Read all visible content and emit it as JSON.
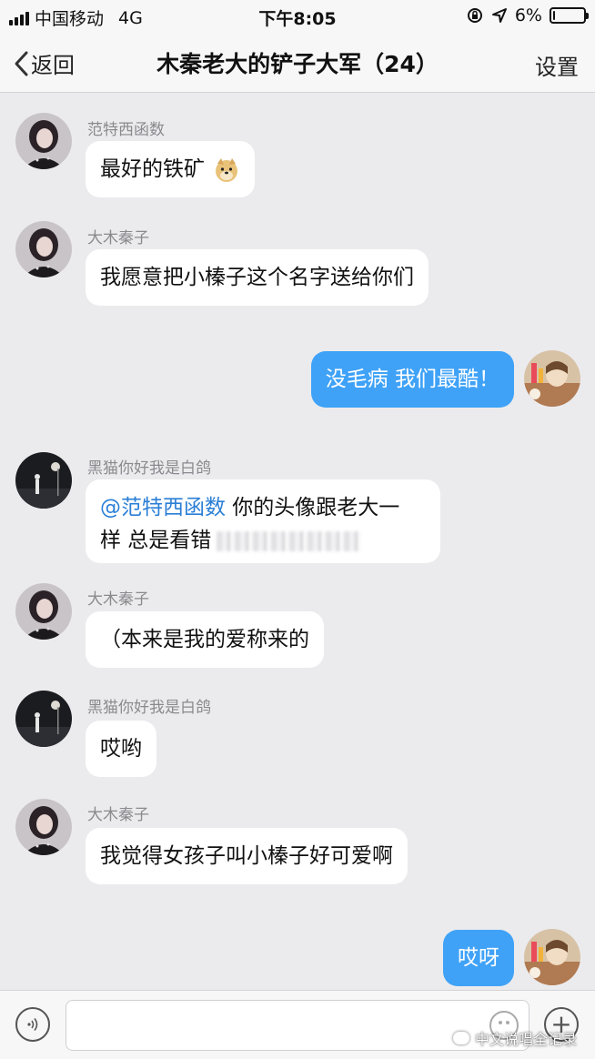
{
  "status_bar": {
    "carrier": "中国移动",
    "network": "4G",
    "time": "下午8:05",
    "battery": "6%",
    "battery_level": 0.06
  },
  "nav": {
    "back_label": "返回",
    "title": "木秦老大的铲子大军（24）",
    "settings_label": "设置"
  },
  "messages": [
    {
      "sender": "范特西函数",
      "text": "最好的铁矿",
      "mine": false
    },
    {
      "sender": "大木秦子",
      "text": "我愿意把小榛子这个名字送给你们",
      "mine": false
    },
    {
      "text": "没毛病 我们最酷！",
      "mine": true
    },
    {
      "sender": "黑猫你好我是白鸽",
      "mention": "@范特西函数",
      "text_line1": " 你的头像跟老大一",
      "text_line2": "样 总是看错",
      "mine": false
    },
    {
      "sender": "大木秦子",
      "text": "（本来是我的爱称来的",
      "mine": false
    },
    {
      "sender": "黑猫你好我是白鸽",
      "text": "哎哟",
      "mine": false
    },
    {
      "sender": "大木秦子",
      "text": "我觉得女孩子叫小榛子好可爱啊",
      "mine": false
    },
    {
      "text": "哎呀",
      "mine": true
    }
  ],
  "input_bar": {
    "placeholder": "",
    "watermark": "中文说唱全记录"
  },
  "colors": {
    "accent": "#3fa2f7",
    "background": "#ebebee"
  }
}
